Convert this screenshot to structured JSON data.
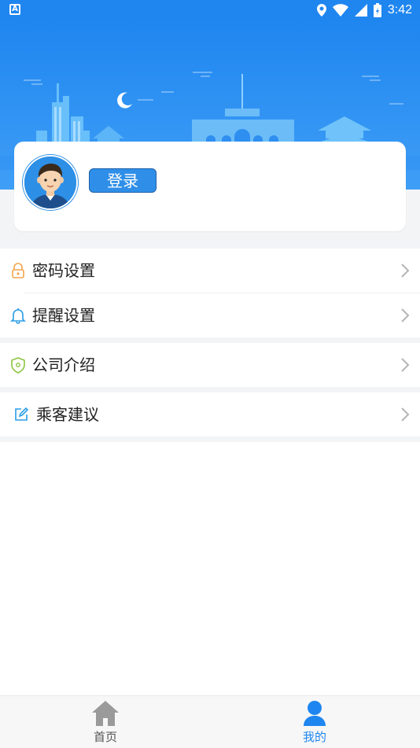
{
  "status_bar": {
    "time": "3:42",
    "left_icon": "A"
  },
  "profile": {
    "login_label": "登录"
  },
  "menu": {
    "items": [
      {
        "label": "密码设置",
        "icon": "lock-icon"
      },
      {
        "label": "提醒设置",
        "icon": "bell-icon"
      },
      {
        "label": "公司介绍",
        "icon": "shield-icon"
      },
      {
        "label": "乘客建议",
        "icon": "edit-icon"
      }
    ]
  },
  "bottom_nav": {
    "tabs": [
      {
        "label": "首页",
        "icon": "home-icon",
        "active": false
      },
      {
        "label": "我的",
        "icon": "user-icon",
        "active": true
      }
    ]
  },
  "colors": {
    "primary": "#1f86f0",
    "inactive": "#9a9a9a",
    "active": "#1f86f0"
  }
}
